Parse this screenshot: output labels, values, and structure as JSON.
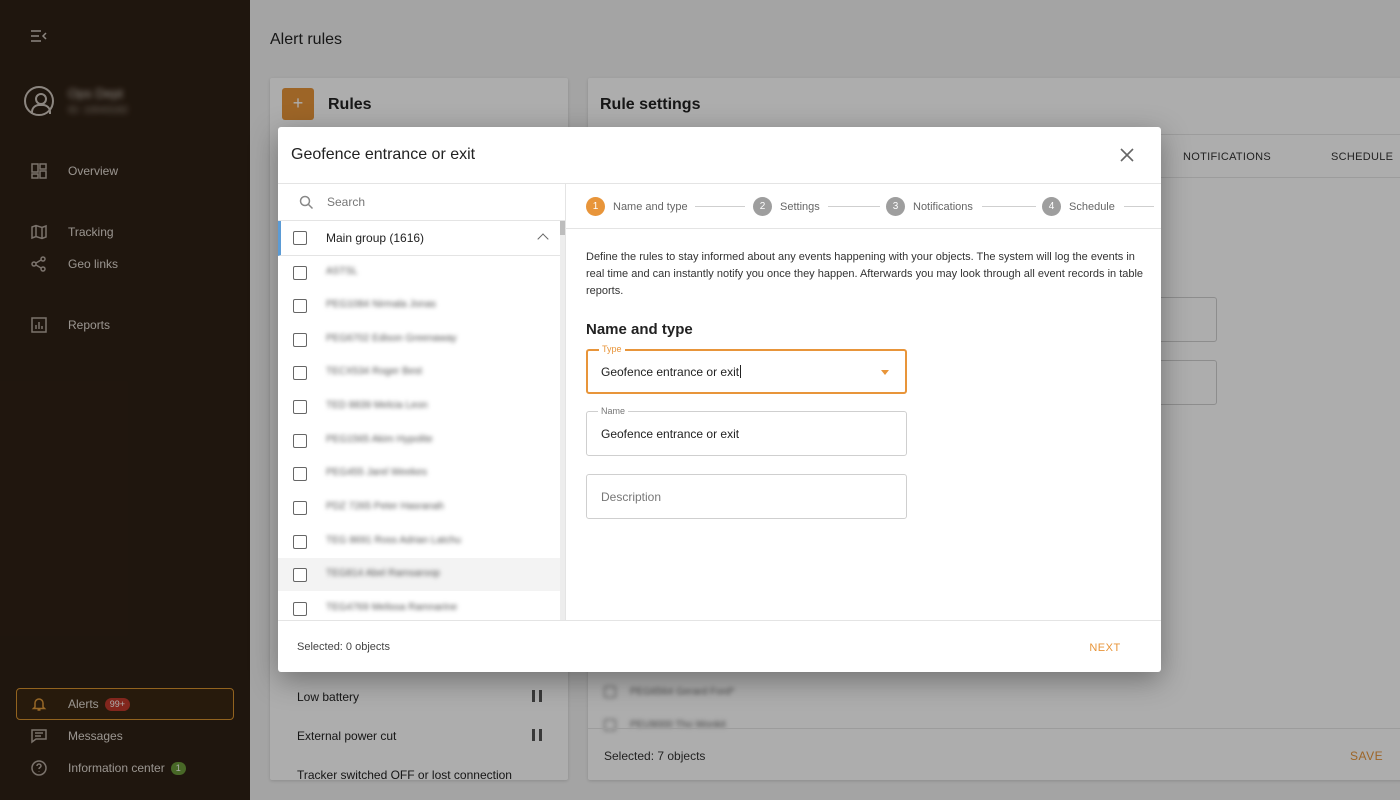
{
  "sidebar": {
    "profile": {
      "name": "Ops Dept",
      "id": "ID: 10043182"
    },
    "items": [
      {
        "label": "Overview",
        "icon": "dashboard-icon"
      },
      {
        "label": "Tracking",
        "icon": "map-icon"
      },
      {
        "label": "Geo links",
        "icon": "share-icon"
      },
      {
        "label": "Reports",
        "icon": "chart-icon"
      },
      {
        "label": "Alerts",
        "icon": "bell-icon",
        "badge": "99+",
        "active": true
      },
      {
        "label": "Messages",
        "icon": "chat-icon"
      },
      {
        "label": "Information center",
        "icon": "help-icon",
        "badge": "1"
      }
    ],
    "colors": {
      "background": "#2f2115",
      "accent": "#e8953a",
      "badge_red": "#c0392b",
      "badge_green": "#6a9a3a"
    }
  },
  "page": {
    "title": "Alert rules",
    "rules_panel": {
      "heading": "Rules",
      "add_label": "+",
      "visible_rules": [
        "Low battery",
        "External power cut",
        "Tracker switched OFF or lost connection"
      ]
    },
    "settings_panel": {
      "heading": "Rule settings",
      "tabs": [
        "NOTIFICATIONS",
        "SCHEDULE"
      ],
      "objects": [
        "PEG6564 Gerard Ford*",
        "PEU9000 Tho Wonkit"
      ],
      "selected": "Selected: 7 objects",
      "save_label": "SAVE"
    }
  },
  "modal": {
    "title": "Geofence entrance or exit",
    "search": {
      "placeholder": "Search"
    },
    "group": {
      "label": "Main group (1616)"
    },
    "objects": [
      "ASTSL",
      "PEG1084 Nirmala Jonas",
      "PEG6702 Edison Greenaway",
      "TECX534 Roger Best",
      "TED 8839 Melcia Leon",
      "PEG1565 Akim Hypolite",
      "PEG455 Jarel Weekes",
      "PDZ 7265 Peter Hasranah",
      "TEG 8691 Ross Adrian Latchu",
      "TEG814 Abel Ramsaroop",
      "TEG4769 Melissa Ramnarine"
    ],
    "steps": [
      {
        "num": "1",
        "label": "Name and type",
        "active": true
      },
      {
        "num": "2",
        "label": "Settings"
      },
      {
        "num": "3",
        "label": "Notifications"
      },
      {
        "num": "4",
        "label": "Schedule"
      }
    ],
    "intro": "Define the rules to stay informed about any events happening with your objects. The system will log the events in real time and can instantly notify you once they happen. Afterwards you may look through all event records in table reports.",
    "section_title": "Name and type",
    "type_field": {
      "label": "Type",
      "value": "Geofence entrance or exit"
    },
    "name_field": {
      "label": "Name",
      "value": "Geofence entrance or exit"
    },
    "description_field": {
      "placeholder": "Description"
    },
    "selected_count": "Selected: 0 objects",
    "next_label": "NEXT"
  }
}
